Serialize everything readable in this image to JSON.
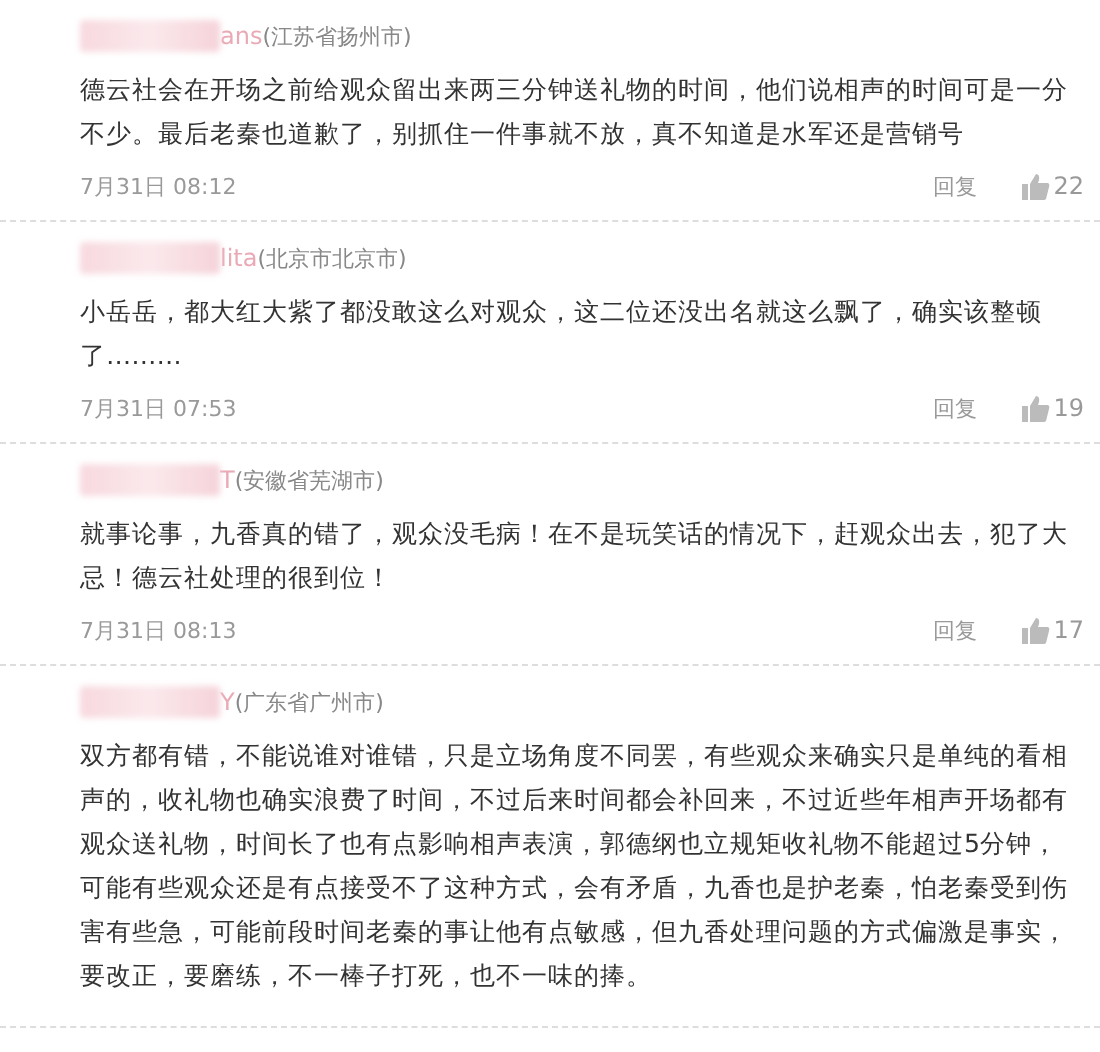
{
  "comments": [
    {
      "user": "ans",
      "region": "(江苏省扬州市)",
      "text": "德云社会在开场之前给观众留出来两三分钟送礼物的时间，他们说相声的时间可是一分不少。最后老秦也道歉了，别抓住一件事就不放，真不知道是水军还是营销号",
      "time": "7月31日 08:12",
      "reply": "回复",
      "likes": "22"
    },
    {
      "user": "lita",
      "region": "(北京市北京市)",
      "text": "小岳岳，都大红大紫了都没敢这么对观众，这二位还没出名就这么飘了，确实该整顿了………",
      "time": "7月31日 07:53",
      "reply": "回复",
      "likes": "19"
    },
    {
      "user": "T",
      "region": "(安徽省芜湖市)",
      "text": "就事论事，九香真的错了，观众没毛病！在不是玩笑话的情况下，赶观众出去，犯了大忌！德云社处理的很到位！",
      "time": "7月31日 08:13",
      "reply": "回复",
      "likes": "17"
    },
    {
      "user": "Y",
      "region": "(广东省广州市)",
      "text": "双方都有错，不能说谁对谁错，只是立场角度不同罢，有些观众来确实只是单纯的看相声的，收礼物也确实浪费了时间，不过后来时间都会补回来，不过近些年相声开场都有观众送礼物，时间长了也有点影响相声表演，郭德纲也立规矩收礼物不能超过5分钟，可能有些观众还是有点接受不了这种方式，会有矛盾，九香也是护老秦，怕老秦受到伤害有些急，可能前段时间老秦的事让他有点敏感，但九香处理问题的方式偏激是事实，要改正，要磨练，不一棒子打死，也不一味的捧。"
    }
  ]
}
